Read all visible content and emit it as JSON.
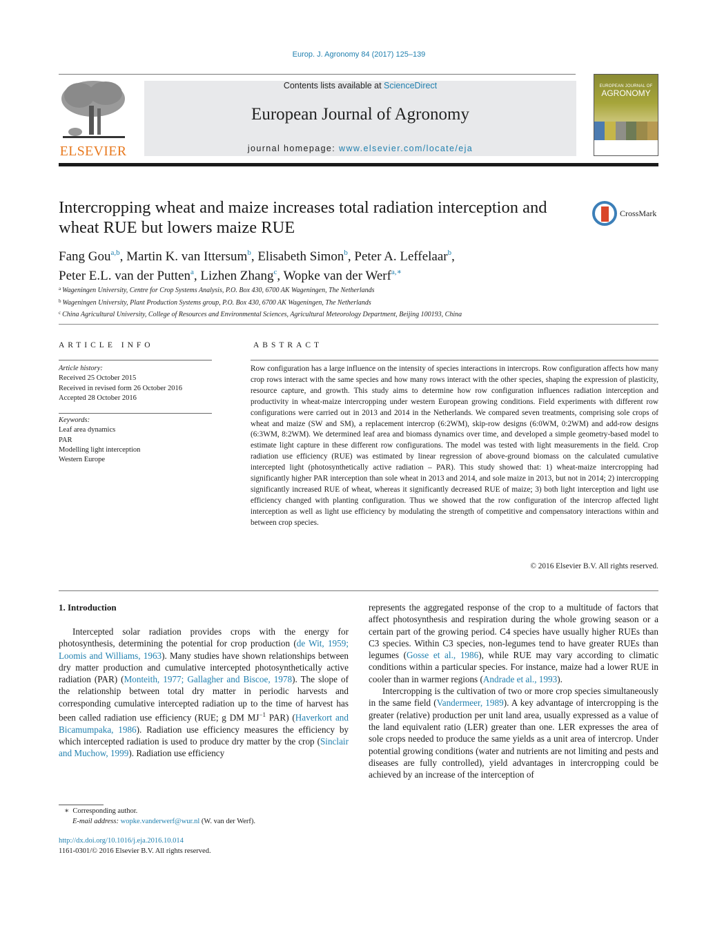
{
  "header": {
    "journal_ref": "Europ. J. Agronomy 84 (2017) 125–139",
    "contents_prefix": "Contents lists available at ",
    "contents_link": "ScienceDirect",
    "journal_title": "European Journal of Agronomy",
    "homepage_prefix": "journal homepage: ",
    "homepage_link": "www.elsevier.com/locate/eja",
    "publisher_logo": "ELSEVIER",
    "cover": {
      "small_title": "EUROPEAN JOURNAL OF",
      "big_title": "AGRONOMY"
    },
    "crossmark_label": "CrossMark"
  },
  "article": {
    "title": "Intercropping wheat and maize increases total radiation interception and wheat RUE but lowers maize RUE",
    "authors": [
      {
        "name": "Fang Gou",
        "aff": "a,b",
        "sep": ", "
      },
      {
        "name": "Martin K. van Ittersum",
        "aff": "b",
        "sep": ", "
      },
      {
        "name": "Elisabeth Simon",
        "aff": "b",
        "sep": ", "
      },
      {
        "name": "Peter A. Leffelaar",
        "aff": "b",
        "sep": ","
      },
      {
        "name": "Peter E.L. van der Putten",
        "aff": "a",
        "sep": ", "
      },
      {
        "name": "Lizhen Zhang",
        "aff": "c",
        "sep": ", "
      },
      {
        "name": "Wopke van der Werf",
        "aff": "a,∗",
        "sep": ""
      }
    ],
    "affiliations": [
      {
        "key": "a",
        "text": "Wageningen University, Centre for Crop Systems Analysis, P.O. Box 430, 6700 AK Wageningen, The Netherlands"
      },
      {
        "key": "b",
        "text": "Wageningen University, Plant Production Systems group, P.O. Box 430, 6700 AK Wageningen, The Netherlands"
      },
      {
        "key": "c",
        "text": "China Agricultural University, College of Resources and Environmental Sciences, Agricultural Meteorology Department, Beijing 100193, China"
      }
    ]
  },
  "article_info": {
    "heading": "ARTICLE INFO",
    "history_label": "Article history:",
    "history": [
      "Received 25 October 2015",
      "Received in revised form 26 October 2016",
      "Accepted 28 October 2016"
    ],
    "keywords_label": "Keywords:",
    "keywords": [
      "Leaf area dynamics",
      "PAR",
      "Modelling light interception",
      "Western Europe"
    ]
  },
  "abstract": {
    "heading": "ABSTRACT",
    "text": "Row configuration has a large influence on the intensity of species interactions in intercrops. Row con­figuration affects how many crop rows interact with the same species and how many rows interact with the other species, shaping the expression of plasticity, resource capture, and growth. This study aims to determine how row configuration influences radiation interception and productivity in wheat-maize intercropping under western European growing conditions. Field experiments with different row configurations were carried out in 2013 and 2014 in the Netherlands. We compared seven treatments, comprising sole crops of wheat and maize (SW and SM), a replacement intercrop (6:2WM), skip-row designs (6:0WM, 0:2WM) and add-row designs (6:3WM, 8:2WM). We determined leaf area and biomass dynamics over time, and developed a simple geometry-based model to estimate light capture in these dif­ferent row configurations. The model was tested with light measurements in the field. Crop radiation use efficiency (RUE) was estimated by linear regression of above-ground biomass on the calculated cumula­tive intercepted light (photosynthetically active radiation – PAR). This study showed that: 1) wheat-maize intercropping had significantly higher PAR interception than sole wheat in 2013 and 2014, and sole maize in 2013, but not in 2014; 2) intercropping significantly increased RUE of wheat, whereas it significantly decreased RUE of maize; 3) both light interception and light use efficiency changed with planting config­uration. Thus we showed that the row configuration of the intercrop affected light interception as well as light use efficiency by modulating the strength of competitive and compensatory interactions within and between crop species.",
    "copyright": "© 2016 Elsevier B.V. All rights reserved."
  },
  "introduction": {
    "heading": "1.  Introduction",
    "left_p1": [
      {
        "t": "Intercepted solar radiation provides crops with the energy for photosynthesis, determining the potential for crop production ("
      },
      {
        "t": "de Wit, 1959; Loomis and Williams, 1963",
        "link": true
      },
      {
        "t": "). Many studies have shown relationships between dry matter production and cumulative inter­cepted photosynthetically active radiation (PAR) ("
      },
      {
        "t": "Monteith, 1977; Gallagher and Biscoe, 1978",
        "link": true
      },
      {
        "t": "). The slope of the relationship between total dry matter in periodic harvests and corresponding cumula­tive intercepted radiation up to the time of harvest has been called radiation use efficiency (RUE; g DM MJ"
      },
      {
        "t": "−1",
        "sup": true
      },
      {
        "t": " PAR) ("
      },
      {
        "t": "Haverkort and Bicamumpaka, 1986",
        "link": true
      },
      {
        "t": "). Radiation use efficiency measures the effi­ciency by which intercepted radiation is used to produce dry matter by the crop ("
      },
      {
        "t": "Sinclair and Muchow, 1999",
        "link": true
      },
      {
        "t": "). Radiation use efficiency"
      }
    ],
    "right_p1": [
      {
        "t": "represents the aggregated response of the crop to a multitude of factors that affect photosynthesis and respiration during the whole growing season or a certain part of the growing period. C4 species have usually higher RUEs than C3 species. Within C3 species, non-legumes tend to have greater RUEs than legumes ("
      },
      {
        "t": "Gosse et al., 1986",
        "link": true
      },
      {
        "t": "), while RUE may vary according to climatic conditions within a particular species. For instance, maize had a lower RUE in cooler than in warmer regions ("
      },
      {
        "t": "Andrade et al., 1993",
        "link": true
      },
      {
        "t": ")."
      }
    ],
    "right_p2": [
      {
        "t": "Intercropping is the cultivation of two or more crop species simultaneously in the same field ("
      },
      {
        "t": "Vandermeer, 1989",
        "link": true
      },
      {
        "t": "). A key advan­tage of intercropping is the greater (relative) production per unit land area, usually expressed as a value of the land equivalent ratio (LER) greater than one. LER expresses the area of sole crops needed to produce the same yields as a unit area of intercrop. Under poten­tial growing conditions (water and nutrients are not limiting and pests and diseases are fully controlled), yield advantages in inter­cropping could be achieved by an increase of the interception of"
      }
    ]
  },
  "footnote": {
    "star": "∗",
    "corresponding": "Corresponding author.",
    "email_label": "E-mail address:",
    "email": "wopke.vanderwerf@wur.nl",
    "email_suffix": " (W. van der Werf).",
    "doi": "http://dx.doi.org/10.1016/j.eja.2016.10.014",
    "issn_copyright": "1161-0301/© 2016 Elsevier B.V. All rights reserved."
  },
  "colors": {
    "link": "#1f7fae",
    "elsevier_orange": "#e87a20",
    "masthead_bg": "#e8e9eb"
  }
}
